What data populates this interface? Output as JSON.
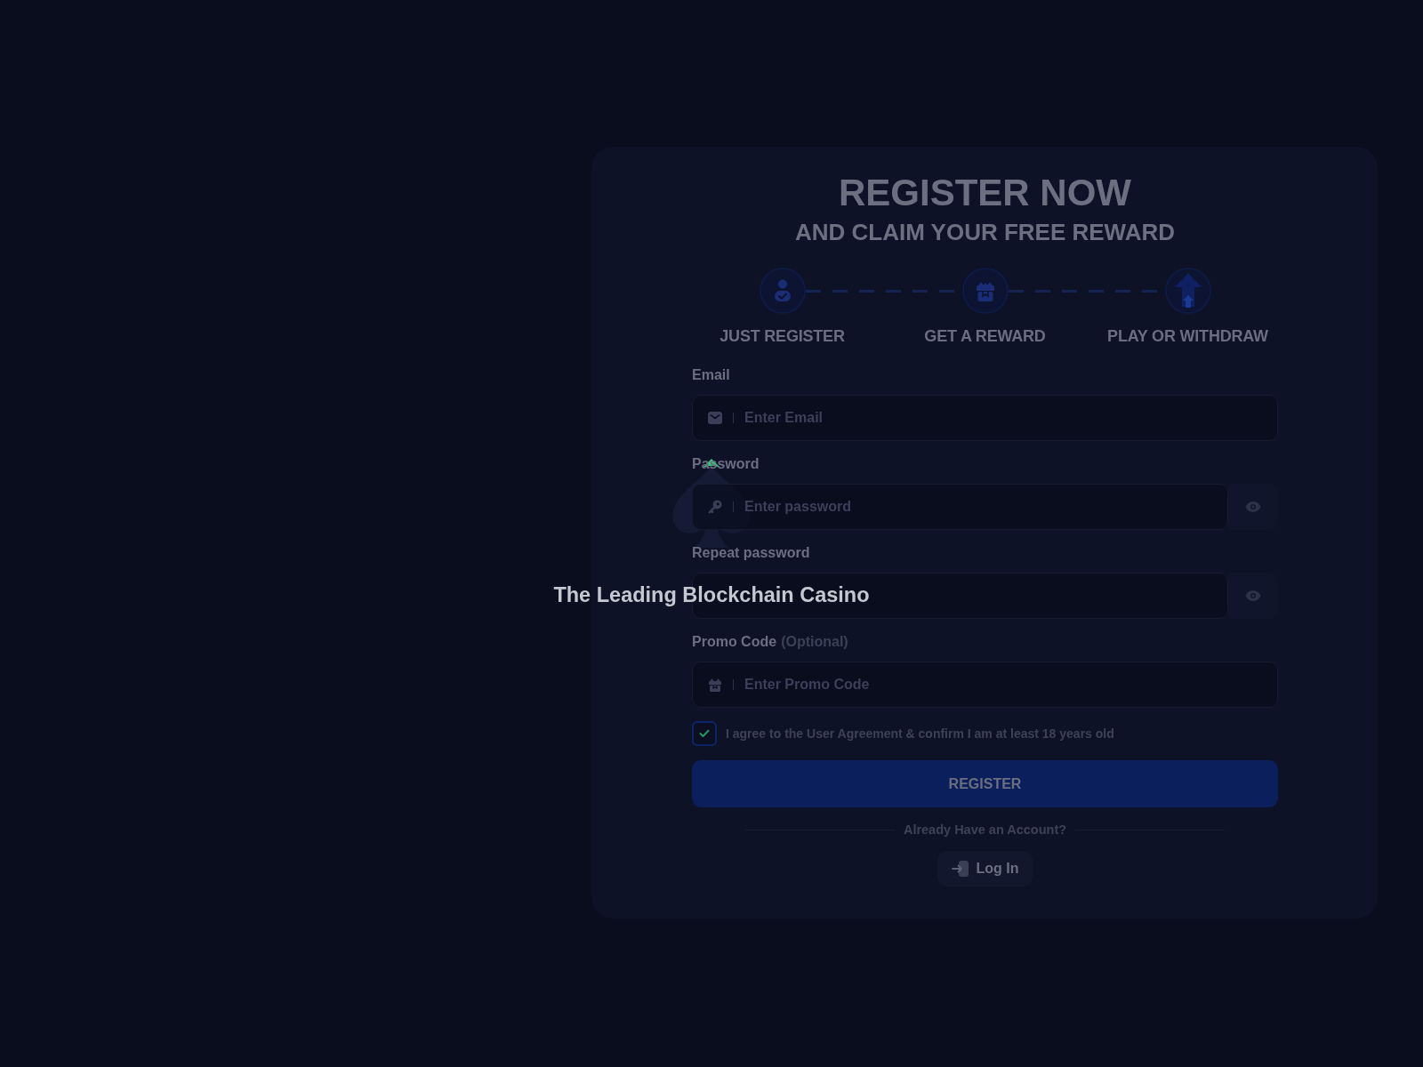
{
  "register_card": {
    "title": "REGISTER NOW",
    "subtitle": "AND CLAIM YOUR FREE REWARD",
    "steps": [
      {
        "kind": "register",
        "label": "JUST REGISTER"
      },
      {
        "kind": "reward",
        "label": "GET A REWARD"
      },
      {
        "kind": "withdraw",
        "label": "PLAY OR WITHDRAW"
      }
    ],
    "fields": [
      {
        "kind": "email",
        "label": "Email",
        "placeholder": "Enter Email"
      },
      {
        "kind": "password",
        "label": "Password",
        "placeholder": "Enter password"
      },
      {
        "kind": "confirm",
        "label": "Repeat password"
      },
      {
        "kind": "promo",
        "label": "Promo Code",
        "hint": "(Optional)",
        "placeholder": "Enter Promo Code"
      }
    ],
    "agreement": {
      "checked": true,
      "text": "I agree to the User Agreement & confirm I am at least 18 years old"
    },
    "register_button": "REGISTER",
    "login_prompt": "Already Have an Account?",
    "login_button": "Log In"
  },
  "loading_overlay": {
    "tagline": "The Leading Blockchain Casino"
  }
}
